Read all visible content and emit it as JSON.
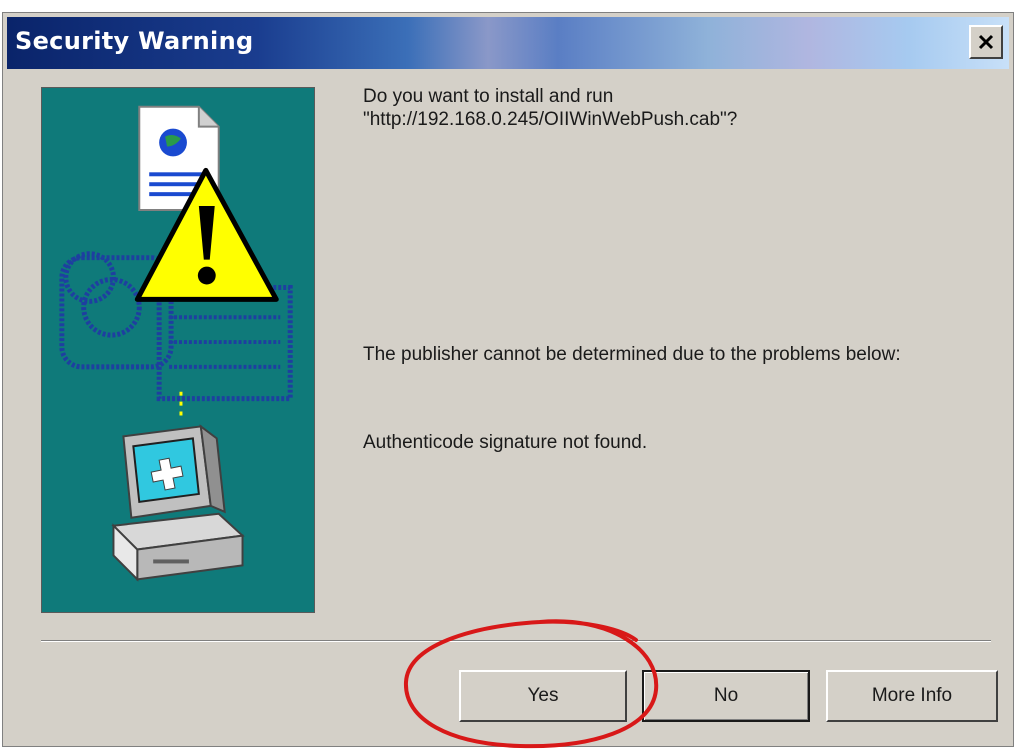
{
  "window": {
    "title": "Security Warning",
    "close_label": "×"
  },
  "message": {
    "question_line1": "Do you want to install and run",
    "question_line2": "\"http://192.168.0.245/OIIWinWebPush.cab\"?",
    "publisher_notice": "The publisher cannot be determined due to the problems below:",
    "signature_problem": "Authenticode signature not found."
  },
  "buttons": {
    "yes": "Yes",
    "no": "No",
    "more_info": "More Info"
  },
  "illustration": {
    "icons": [
      "document-globe-icon",
      "warning-triangle-icon",
      "network-diagram-icon",
      "computer-icon"
    ]
  },
  "colors": {
    "title_bar_start": "#0a246a",
    "dialog_background": "#d4d0c8",
    "illustration_background": "#0f7a7a",
    "warning_yellow": "#ffff00",
    "annotation_circle": "#d81818"
  }
}
